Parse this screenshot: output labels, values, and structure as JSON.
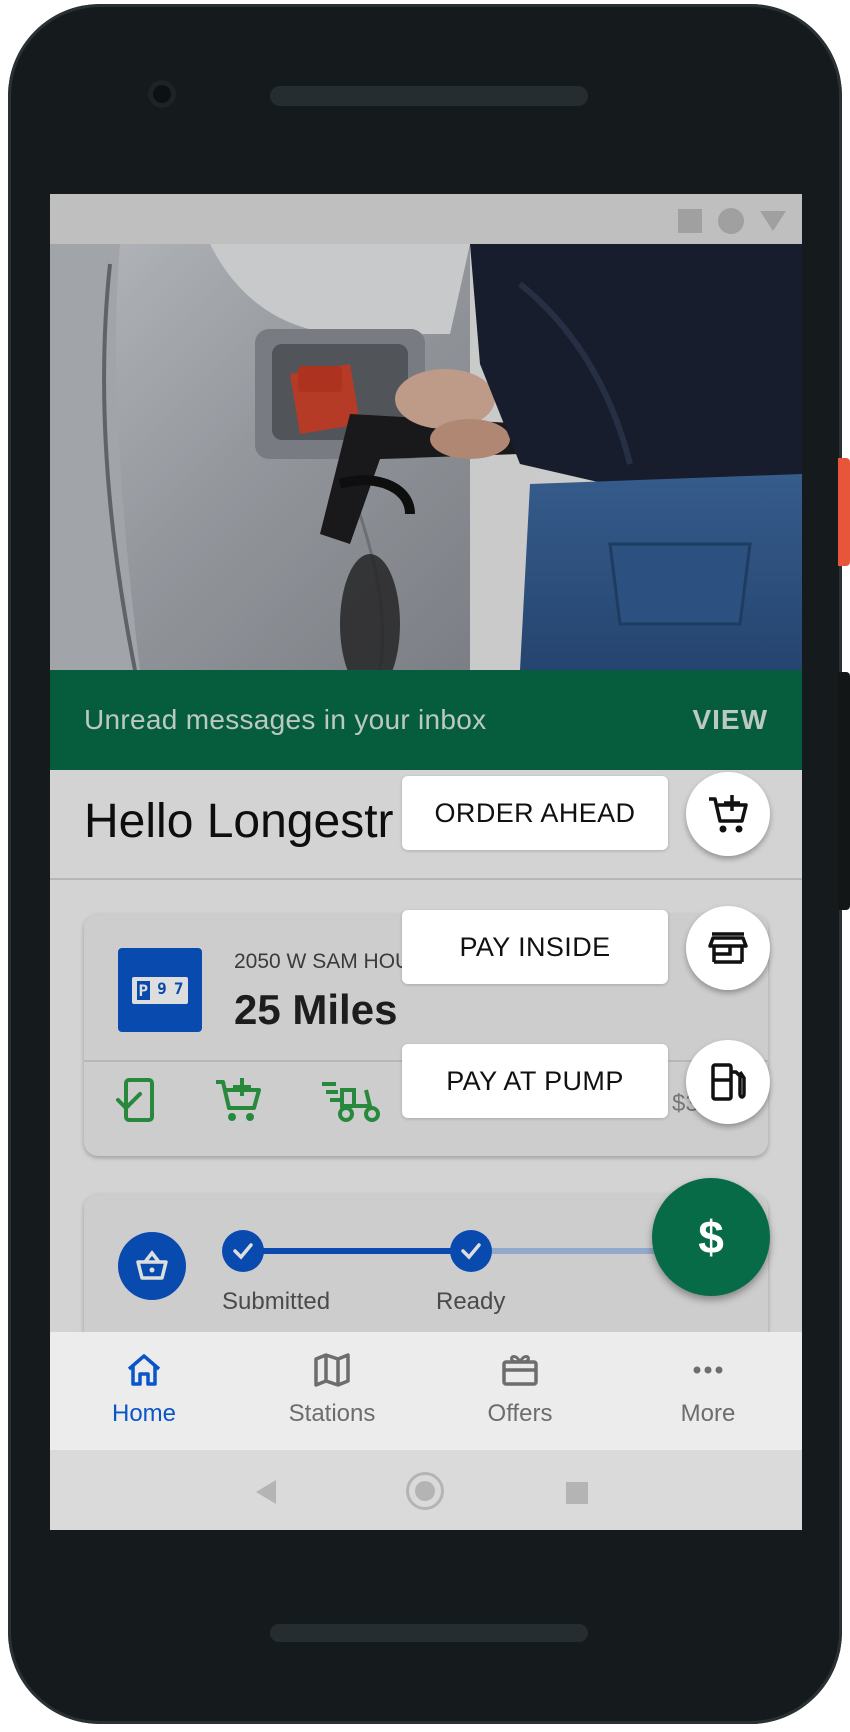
{
  "banner": {
    "text": "Unread messages in your inbox",
    "action": "VIEW"
  },
  "greeting": "Hello Longestr",
  "station": {
    "address": "2050 W SAM HOU",
    "distance": "25 Miles",
    "price_partial": "$3",
    "logo_letters": [
      "P",
      "9",
      "7"
    ]
  },
  "order_progress": {
    "steps": [
      {
        "label": "Submitted",
        "done": true
      },
      {
        "label": "Ready",
        "done": true
      }
    ]
  },
  "speed_dial": {
    "order_ahead": "ORDER AHEAD",
    "pay_inside": "PAY INSIDE",
    "pay_at_pump": "PAY AT PUMP",
    "main_symbol": "$"
  },
  "bottom_nav": {
    "home": "Home",
    "stations": "Stations",
    "offers": "Offers",
    "more": "More"
  },
  "colors": {
    "brand_green": "#076b47",
    "accent_blue": "#0a56c8",
    "service_green": "#2f9e46"
  }
}
